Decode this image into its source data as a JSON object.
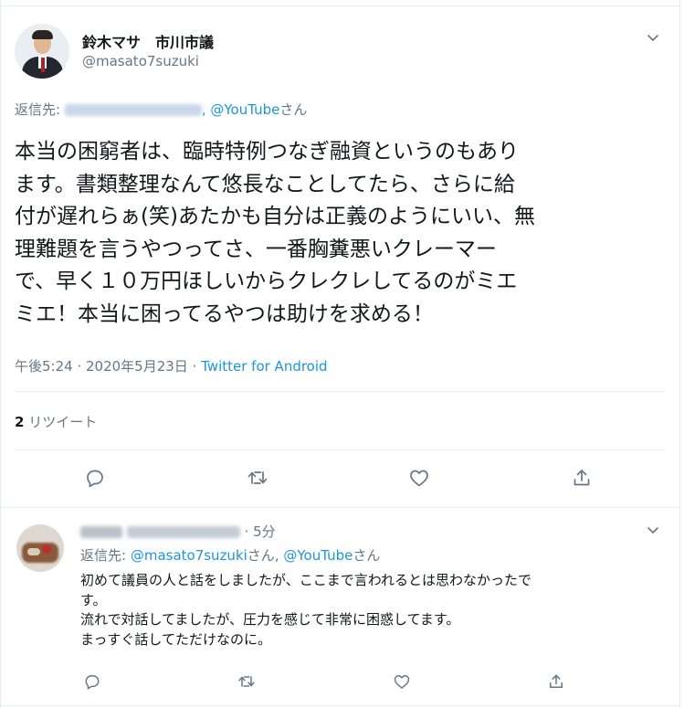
{
  "tweet": {
    "display_name": "鈴木マサ　市川市議",
    "handle": "@masato7suzuki",
    "reply_prefix": "返信先: ",
    "reply_to_youtube": "@YouTube",
    "reply_suffix": "さん",
    "text_lines": [
      "本当の困窮者は、臨時特例つなぎ融資というのもあり",
      "ます。書類整理なんて悠長なことしてたら、さらに給",
      "付が遅れらぁ(笑)あたかも自分は正義のようにいい、無",
      "理難題を言うやつってさ、一番胸糞悪いクレーマー",
      "で、早く１０万円ほしいからクレクレしてるのがミエ",
      "ミエ！本当に困ってるやつは助けを求める！"
    ],
    "time": "午後5:24",
    "separator": " · ",
    "date": "2020年5月23日",
    "source": "Twitter for Android",
    "retweet_count": "2",
    "retweet_label": "リツイート"
  },
  "reply": {
    "time_ago": "5分",
    "reply_prefix": "返信先: ",
    "reply_to_user": "@masato7suzuki",
    "reply_to_youtube": "@YouTube",
    "san": "さん",
    "comma": ", ",
    "body_lines": [
      "初めて議員の人と話をしましたが、ここまで言われるとは思わなかったで",
      "す。",
      "流れで対話してましたが、圧力を感じて非常に困惑してます。",
      "まっすぐ話してただけなのに。"
    ]
  },
  "icons": [
    "chevron-down-icon",
    "reply-icon",
    "retweet-icon",
    "like-icon",
    "share-icon"
  ],
  "colors": {
    "link": "#1b95e0",
    "secondary_text": "#657786",
    "primary_text": "#14171a",
    "border": "#e6ecf0"
  }
}
